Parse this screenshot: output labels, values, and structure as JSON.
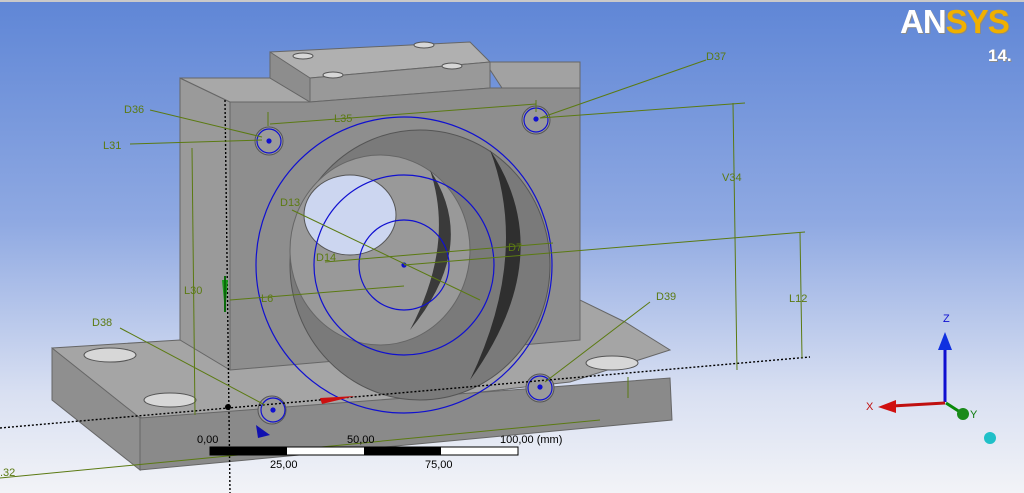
{
  "app": {
    "logo_part1": "AN",
    "logo_part2": "SYS",
    "version": "14."
  },
  "dimensions": {
    "D37": "D37",
    "D36": "D36",
    "L31": "L31",
    "L35": "L35",
    "V34": "V34",
    "D13": "D13",
    "D14": "D14",
    "D7": "D7",
    "L30": "L30",
    "L6": "L6",
    "L12": "L12",
    "D38": "D38",
    "D39": "D39",
    "L32": ".32"
  },
  "scale_bar": {
    "top_labels": [
      "0,00",
      "50,00",
      "100,00 (mm)"
    ],
    "bottom_labels": [
      "25,00",
      "75,00"
    ]
  },
  "triad": {
    "z": "Z",
    "x": "X",
    "y": "Y"
  },
  "colors": {
    "background_top": "#5f86d6",
    "background_bottom": "#f2f3f7",
    "dimension_green": "#5b7a12",
    "sketch_blue": "#1010d0",
    "part_gray": "#8c8c8c",
    "logo_accent": "#f0b000"
  }
}
